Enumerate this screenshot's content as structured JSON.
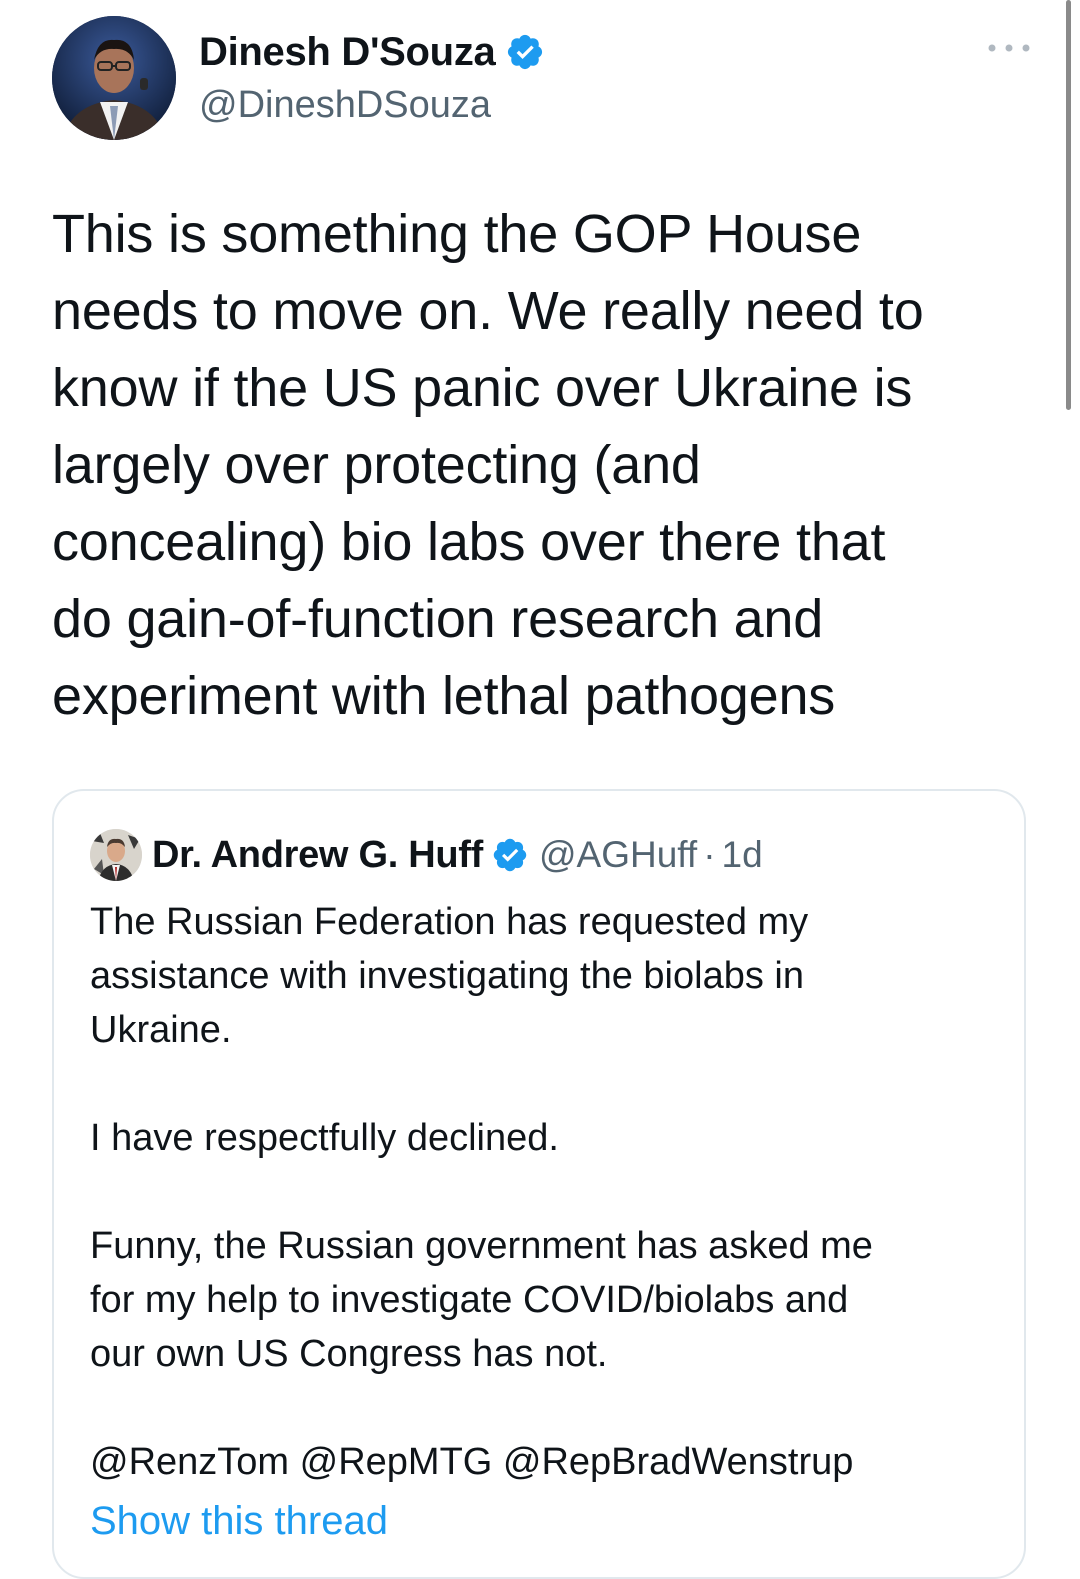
{
  "tweet": {
    "author": {
      "display_name": "Dinesh D'Souza",
      "handle": "@DineshDSouza",
      "verified_icon": "verified-badge-icon"
    },
    "more_icon": "more-options-icon",
    "text_lines": [
      "This is something the GOP House",
      "needs to move on. We really need to",
      "know if the US panic over Ukraine is",
      "largely over protecting (and",
      "concealing) bio labs over there that",
      "do gain-of-function research and",
      "experiment with lethal pathogens"
    ]
  },
  "quoted_tweet": {
    "author": {
      "display_name": "Dr. Andrew G. Huff",
      "handle": "@AGHuff",
      "separator": "·",
      "time": "1d"
    },
    "paragraphs": [
      [
        "The Russian Federation has requested my",
        "assistance with investigating the biolabs in",
        "Ukraine."
      ],
      [
        "I have respectfully declined."
      ],
      [
        "Funny, the Russian government has asked me",
        "for my help to investigate COVID/biolabs and",
        "our own US Congress has not."
      ],
      [
        "@RenzTom @RepMTG @RepBradWenstrup"
      ]
    ],
    "show_thread_label": "Show this thread"
  },
  "colors": {
    "text_primary": "#0f1419",
    "text_secondary": "#536471",
    "link": "#1d9bf0",
    "verified": "#1d9bf0",
    "border": "#e1e8ed"
  }
}
